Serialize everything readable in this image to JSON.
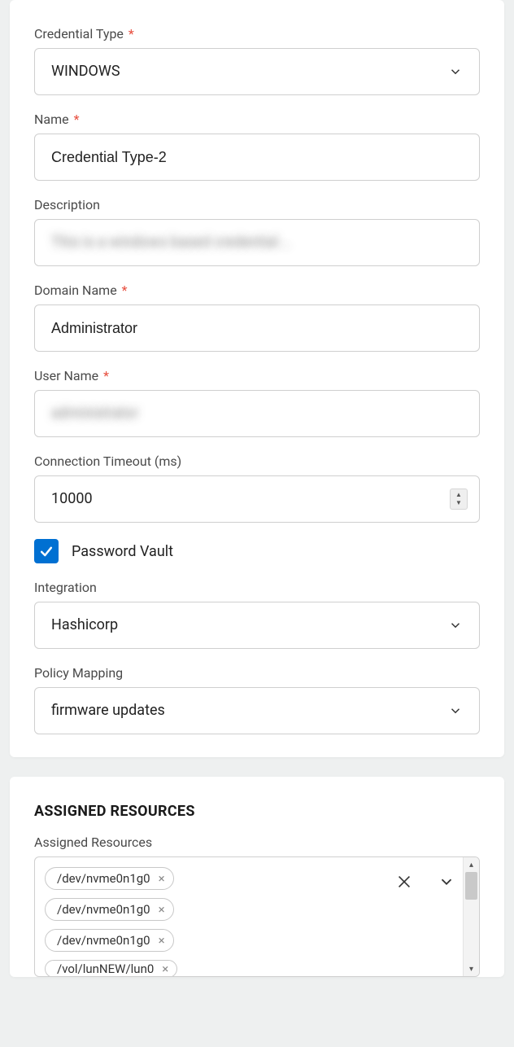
{
  "form": {
    "credential_type": {
      "label": "Credential Type",
      "value": "WINDOWS",
      "required": true
    },
    "name": {
      "label": "Name",
      "value": "Credential Type-2",
      "required": true
    },
    "description": {
      "label": "Description",
      "value": "This is a windows based credential ..",
      "required": false
    },
    "domain_name": {
      "label": "Domain Name",
      "value": "Administrator",
      "required": true
    },
    "user_name": {
      "label": "User Name",
      "value": "administrator",
      "required": true
    },
    "connection_timeout": {
      "label": "Connection Timeout (ms)",
      "value": "10000",
      "required": false
    },
    "password_vault": {
      "label": "Password Vault",
      "checked": true
    },
    "integration": {
      "label": "Integration",
      "value": "Hashicorp"
    },
    "policy_mapping": {
      "label": "Policy Mapping",
      "value": "firmware updates"
    }
  },
  "assigned_resources": {
    "section_title": "ASSIGNED RESOURCES",
    "label": "Assigned Resources",
    "items": [
      "/dev/nvme0n1g0",
      "/dev/nvme0n1g0",
      "/dev/nvme0n1g0",
      "/vol/lunNEW/lun0"
    ]
  }
}
